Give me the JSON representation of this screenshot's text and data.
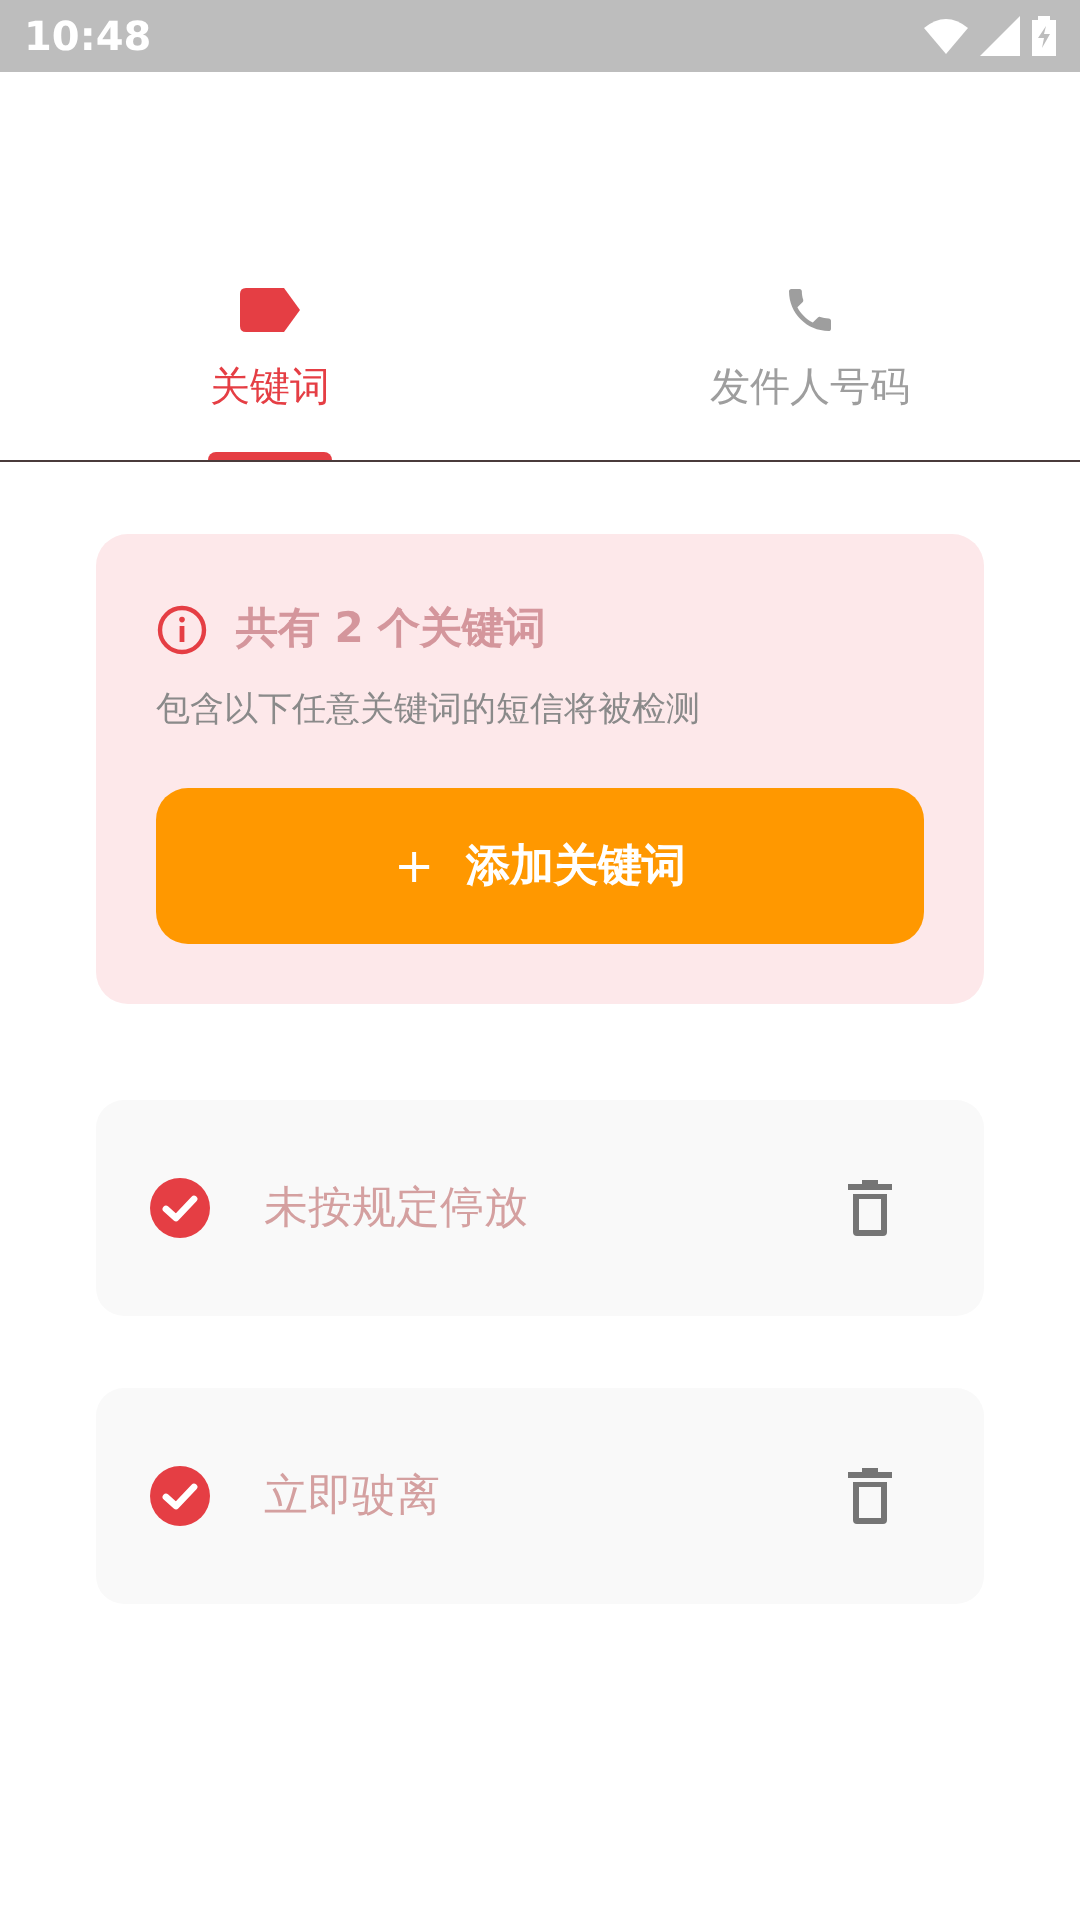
{
  "status_bar": {
    "time": "10:48"
  },
  "tabs": [
    {
      "label": "关键词",
      "kind": "tag",
      "selected": true
    },
    {
      "label": "发件人号码",
      "kind": "phone",
      "selected": false
    }
  ],
  "summary": {
    "title": "共有 2 个关键词",
    "description": "包含以下任意关键词的短信将被检测",
    "add_button": {
      "icon": "+",
      "label": "添加关键词"
    }
  },
  "keywords": [
    {
      "text": "未按规定停放",
      "checked": true
    },
    {
      "text": "立即驶离",
      "checked": true
    }
  ]
}
